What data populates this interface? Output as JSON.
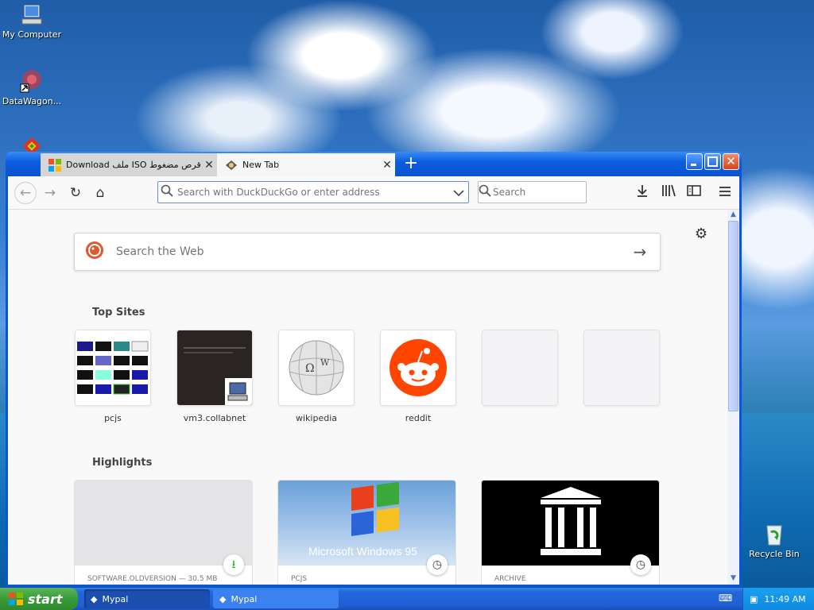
{
  "desktop": {
    "icons": [
      {
        "label": "My Computer"
      },
      {
        "label": "DataWagon..."
      },
      {
        "label": "Recycle Bin"
      }
    ]
  },
  "browser": {
    "tabs": [
      {
        "title": "Download ملف ISO لـ قرص مضغوط"
      },
      {
        "title": "New Tab"
      }
    ],
    "new_tab_symbol": "+",
    "url_placeholder": "Search with DuckDuckGo or enter address",
    "search_placeholder": "Search"
  },
  "newtab": {
    "web_search_placeholder": "Search the Web",
    "top_sites_heading": "Top Sites",
    "top_sites": [
      {
        "label": "pcjs"
      },
      {
        "label": "vm3.collabnet"
      },
      {
        "label": "wikipedia"
      },
      {
        "label": "reddit"
      },
      {
        "label": ""
      },
      {
        "label": ""
      }
    ],
    "highlights_heading": "Highlights",
    "highlights": [
      {
        "meta": "SOFTWARE.OLDVERSION — 30.5 MB",
        "badge": "download-icon"
      },
      {
        "meta": "PCJS",
        "badge": "clock-icon",
        "image_text": "Microsoft Windows 95"
      },
      {
        "meta": "ARCHIVE",
        "badge": "clock-icon"
      }
    ]
  },
  "taskbar": {
    "start_label": "start",
    "tasks": [
      {
        "label": "Mypal"
      },
      {
        "label": "Mypal"
      }
    ],
    "clock": "11:49 AM"
  },
  "colors": {
    "accent": "#0a5ee0",
    "reddit": "#ff4500",
    "start_green": "#389b38"
  }
}
